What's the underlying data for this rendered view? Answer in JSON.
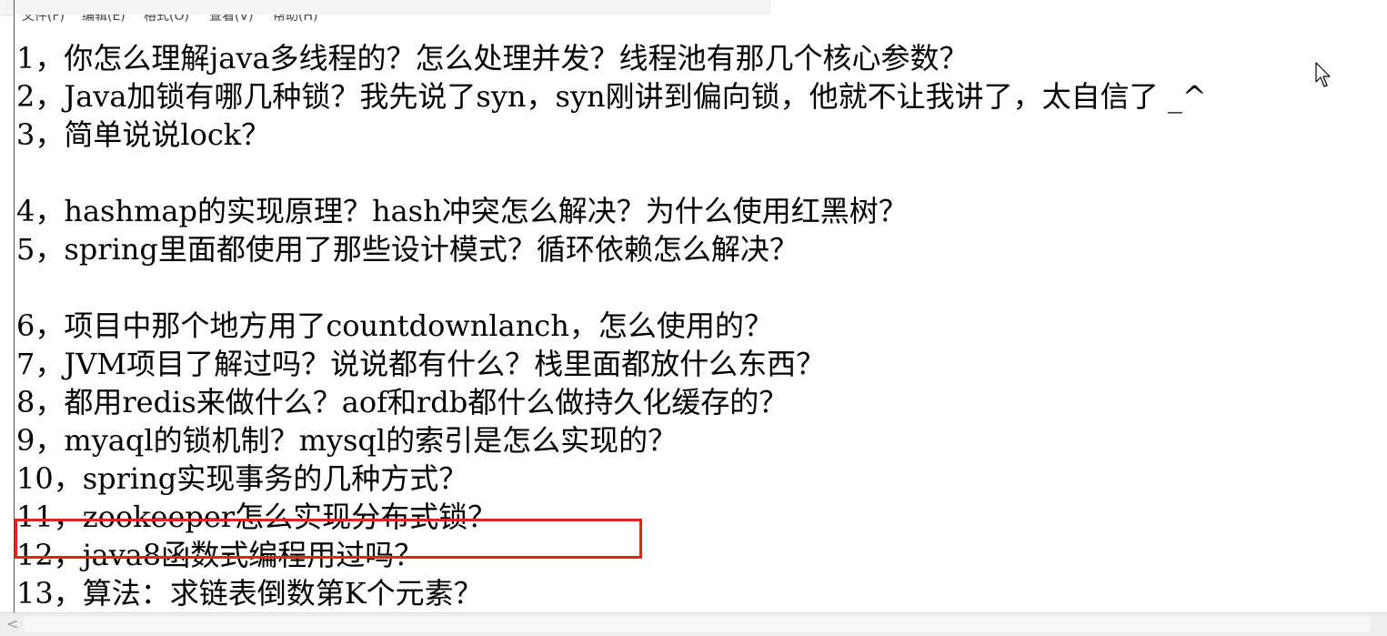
{
  "menubar": {
    "items": [
      "文件(F)",
      "编辑(E)",
      "格式(O)",
      "查看(V)",
      "帮助(H)"
    ]
  },
  "editor": {
    "lines": [
      "1，你怎么理解java多线程的？怎么处理并发？线程池有那几个核心参数？",
      "2，Java加锁有哪几种锁？我先说了syn，syn刚讲到偏向锁，他就不让我讲了，太自信了 _^",
      "3，简单说说lock？",
      "",
      "4，hashmap的实现原理？hash冲突怎么解决？为什么使用红黑树？",
      "5，spring里面都使用了那些设计模式？循环依赖怎么解决？",
      "",
      "6，项目中那个地方用了countdownlanch，怎么使用的？",
      "7，JVM项目了解过吗？说说都有什么？栈里面都放什么东西？",
      "8，都用redis来做什么？aof和rdb都什么做持久化缓存的？",
      "9，myaql的锁机制？mysql的索引是怎么实现的？",
      "10，spring实现事务的几种方式？",
      "11，zookeeper怎么实现分布式锁？",
      "12，java8函数式编程用过吗？",
      "13，算法：求链表倒数第K个元素？"
    ],
    "highlighted_line_index": 13,
    "highlight_color": "#e0251b"
  },
  "scrollbar": {
    "left_arrow_icon": "chevron-left-icon"
  }
}
